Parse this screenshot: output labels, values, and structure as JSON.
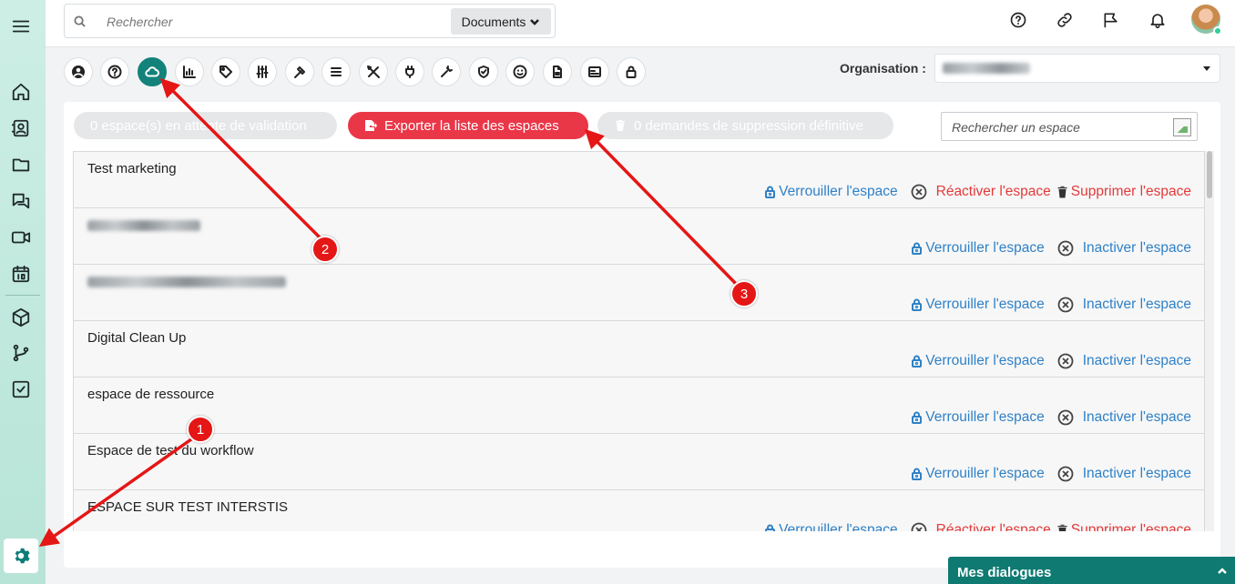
{
  "header": {
    "search_placeholder": "Rechercher",
    "scope_select": "Documents"
  },
  "sidebar": {
    "icons": [
      "menu-icon",
      "home-icon",
      "contacts-icon",
      "folder-icon",
      "chat-icon",
      "video-icon",
      "calendar-icon",
      "box-icon",
      "workflow-icon",
      "tasks-icon"
    ],
    "settings_icon": "gear-icon"
  },
  "topbar_icons": [
    "help-icon",
    "link-icon",
    "flag-icon",
    "bell-icon"
  ],
  "toolbar": {
    "icons": [
      "user-icon",
      "help-icon",
      "cloud-icon",
      "chart-icon",
      "tag-icon",
      "sliders-icon",
      "hammer-icon",
      "list-icon",
      "tools-icon",
      "plug-icon",
      "wrench-icon",
      "shield-icon",
      "smiley-icon",
      "file-icon",
      "card-icon",
      "lock-icon"
    ],
    "active": "cloud-icon"
  },
  "organisation": {
    "label": "Organisation :"
  },
  "actions_bar": {
    "pending": "0 espace(s) en attente de validation",
    "export": "Exporter la liste des espaces",
    "delete_requests": "0 demandes de suppression définitive",
    "space_search_placeholder": "Rechercher un espace"
  },
  "spaces": [
    {
      "name": "Test marketing",
      "state": "inactive"
    },
    {
      "name": "",
      "state": "active"
    },
    {
      "name": "",
      "state": "active"
    },
    {
      "name": "Digital Clean Up",
      "state": "active"
    },
    {
      "name": "espace de ressource",
      "state": "active"
    },
    {
      "name": "Espace de test du workflow",
      "state": "active"
    },
    {
      "name": "ESPACE SUR TEST INTERSTIS",
      "state": "inactive"
    }
  ],
  "labels": {
    "lock": "Verrouiller l'espace",
    "deactivate": "Inactiver l'espace",
    "reactivate": "Réactiver l'espace",
    "delete": "Supprimer l'espace"
  },
  "dialogs": {
    "label": "Mes dialogues"
  },
  "annotations": [
    "1",
    "2",
    "3"
  ],
  "colors": {
    "accent": "#13827a",
    "danger": "#ea3748",
    "link": "#2f81c7",
    "annotation": "#e51616"
  }
}
